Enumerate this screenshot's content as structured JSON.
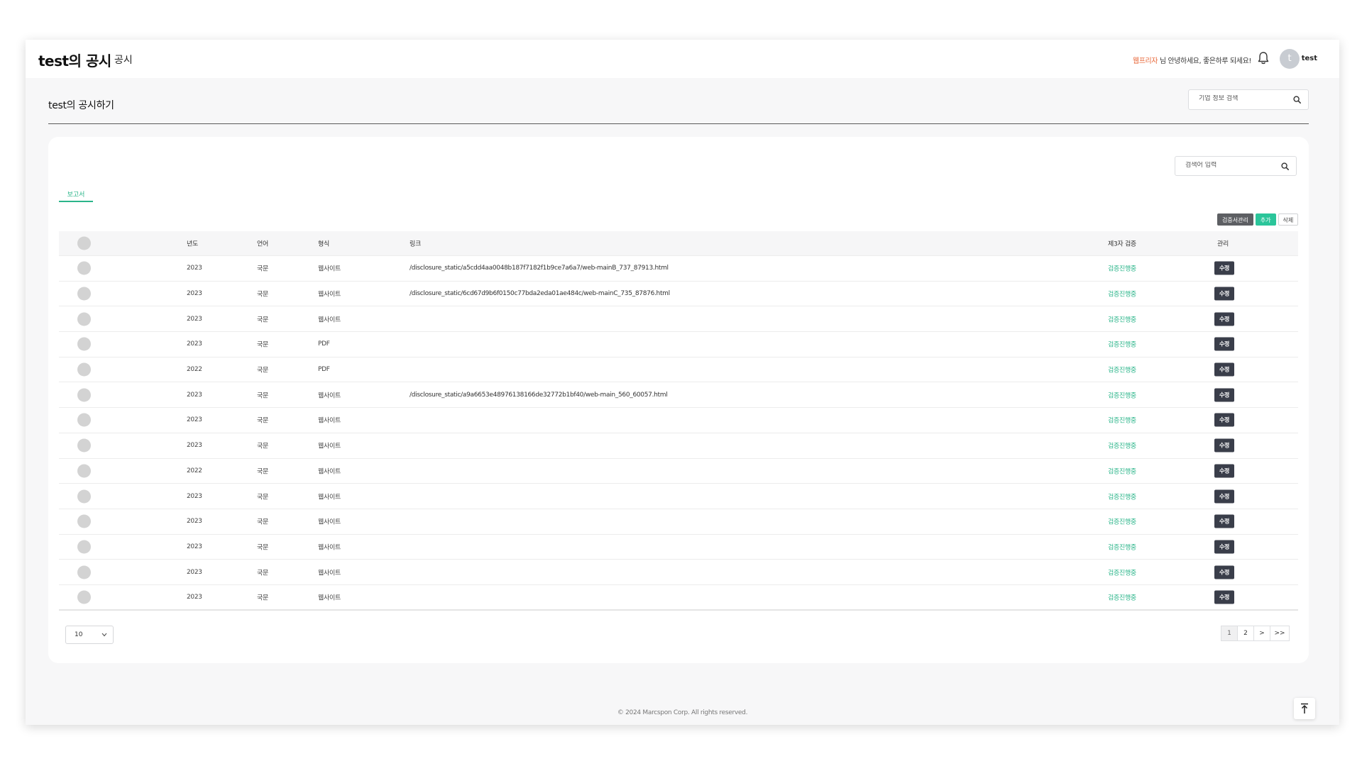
{
  "header": {
    "brand": "test의 공시",
    "section": "공시",
    "greeting_role": "웹프리자",
    "greeting_text": " 님 안녕하세요, 좋은하루 되세요!",
    "avatar_initial": "t",
    "username": "test"
  },
  "page": {
    "title": "test의 공시하기",
    "company_search_placeholder": "기업 정보 검색"
  },
  "card": {
    "search_placeholder": "검색어 입력",
    "tabs": [
      {
        "label": "보고서"
      }
    ],
    "actions": {
      "verifier_manage": "검증서관리",
      "add": "추가",
      "delete": "삭제"
    }
  },
  "table": {
    "headers": {
      "year": "년도",
      "language": "언어",
      "format": "형식",
      "link": "링크",
      "verification": "제3자 검증",
      "manage": "관리"
    },
    "edit_label": "수정",
    "rows": [
      {
        "year": "2023",
        "language": "국문",
        "format": "웹사이트",
        "link": "/disclosure_static/a5cdd4aa0048b187f7182f1b9ce7a6a7/web-mainB_737_87913.html",
        "verification": "검증진행중"
      },
      {
        "year": "2023",
        "language": "국문",
        "format": "웹사이트",
        "link": "/disclosure_static/6cd67d9b6f0150c77bda2eda01ae484c/web-mainC_735_87876.html",
        "verification": "검증진행중"
      },
      {
        "year": "2023",
        "language": "국문",
        "format": "웹사이트",
        "link": "",
        "verification": "검증진행중"
      },
      {
        "year": "2023",
        "language": "국문",
        "format": "PDF",
        "link": "",
        "verification": "검증진행중"
      },
      {
        "year": "2022",
        "language": "국문",
        "format": "PDF",
        "link": "",
        "verification": "검증진행중"
      },
      {
        "year": "2023",
        "language": "국문",
        "format": "웹사이트",
        "link": "/disclosure_static/a9a6653e48976138166de32772b1bf40/web-main_560_60057.html",
        "verification": "검증진행중"
      },
      {
        "year": "2023",
        "language": "국문",
        "format": "웹사이트",
        "link": "",
        "verification": "검증진행중"
      },
      {
        "year": "2023",
        "language": "국문",
        "format": "웹사이트",
        "link": "",
        "verification": "검증진행중"
      },
      {
        "year": "2022",
        "language": "국문",
        "format": "웹사이트",
        "link": "",
        "verification": "검증진행중"
      },
      {
        "year": "2023",
        "language": "국문",
        "format": "웹사이트",
        "link": "",
        "verification": "검증진행중"
      },
      {
        "year": "2023",
        "language": "국문",
        "format": "웹사이트",
        "link": "",
        "verification": "검증진행중"
      },
      {
        "year": "2023",
        "language": "국문",
        "format": "웹사이트",
        "link": "",
        "verification": "검증진행중"
      },
      {
        "year": "2023",
        "language": "국문",
        "format": "웹사이트",
        "link": "",
        "verification": "검증진행중"
      },
      {
        "year": "2023",
        "language": "국문",
        "format": "웹사이트",
        "link": "",
        "verification": "검증진행중"
      }
    ]
  },
  "pagination": {
    "page_size": "10",
    "pages": [
      "1",
      "2"
    ],
    "next": ">",
    "last": ">>"
  },
  "footer": {
    "copyright": "© 2024 Marcspon Corp. All rights reserved."
  },
  "colors": {
    "accent_green": "#2bb58a",
    "role_orange": "#e8683a",
    "dark_button": "#3a3e4a"
  },
  "icons": [
    "bell-icon",
    "search-icon",
    "chevron-down-icon",
    "scroll-top-icon"
  ]
}
